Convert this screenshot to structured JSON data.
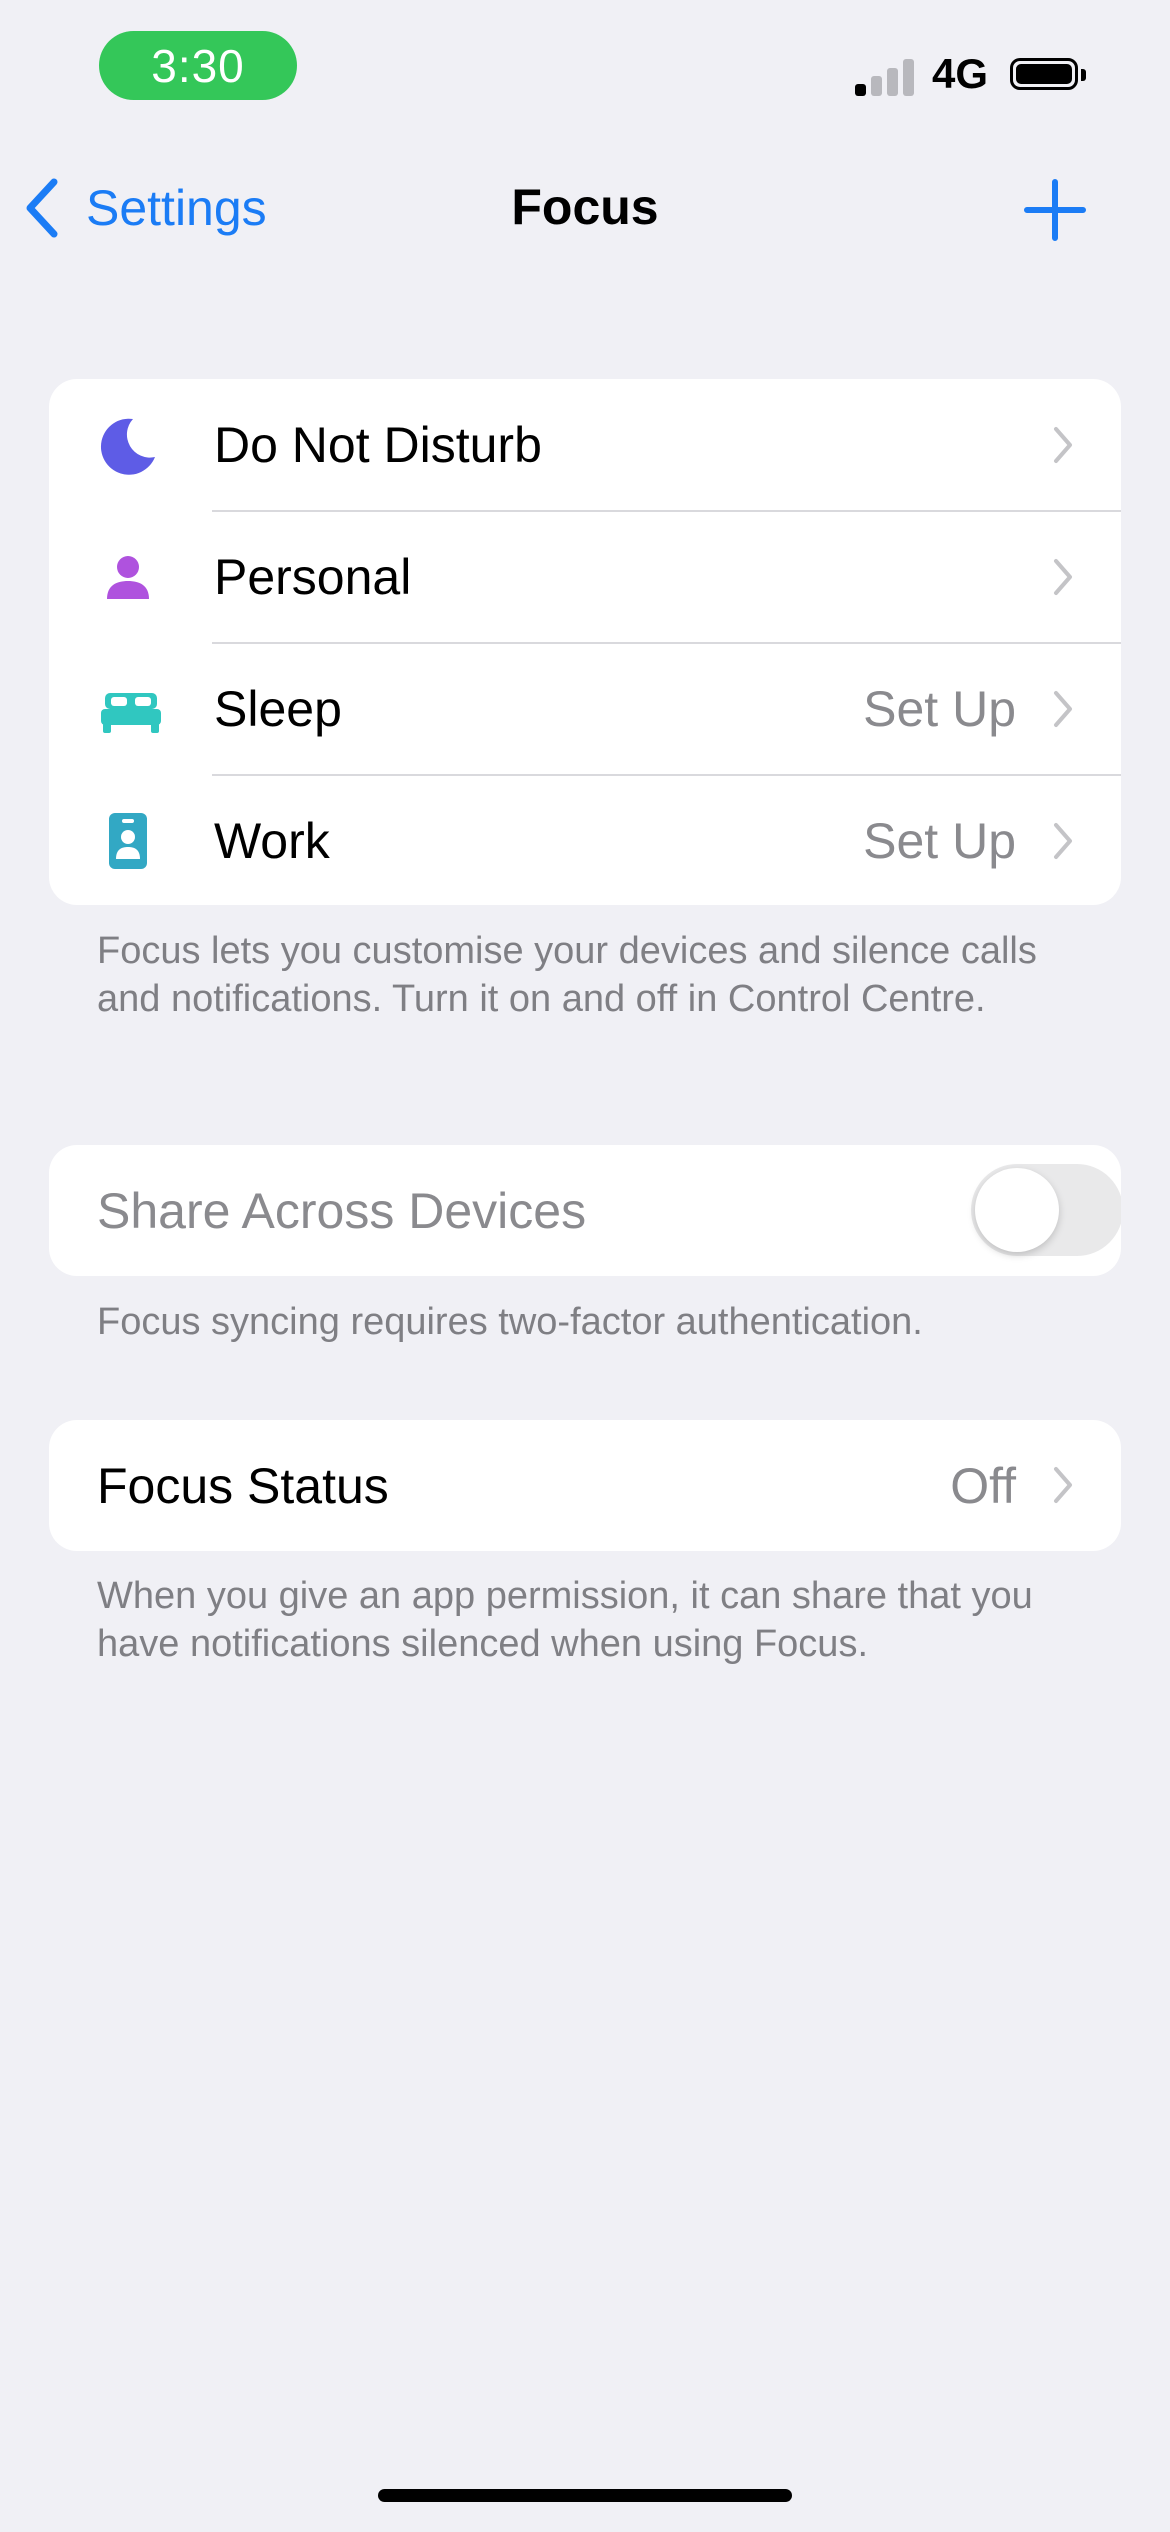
{
  "status_bar": {
    "time": "3:30",
    "network": "4G",
    "signal_bars_active": 1,
    "signal_bars_total": 4,
    "time_pill_color": "#34c759"
  },
  "nav": {
    "back_label": "Settings",
    "title": "Focus",
    "add_icon": "plus-icon",
    "accent_color": "#1b7cf5"
  },
  "focus_modes": [
    {
      "label": "Do Not Disturb",
      "value": "",
      "icon": "moon-icon",
      "icon_color": "#5e5ce6"
    },
    {
      "label": "Personal",
      "value": "",
      "icon": "person-icon",
      "icon_color": "#af52de"
    },
    {
      "label": "Sleep",
      "value": "Set Up",
      "icon": "bed-icon",
      "icon_color": "#30c7c0"
    },
    {
      "label": "Work",
      "value": "Set Up",
      "icon": "id-badge-icon",
      "icon_color": "#32a8c4"
    }
  ],
  "focus_modes_footer": "Focus lets you customise your devices and silence calls and notifications. Turn it on and off in Control Centre.",
  "share": {
    "label": "Share Across Devices",
    "enabled": false,
    "footer": "Focus syncing requires two-factor authentication."
  },
  "focus_status": {
    "label": "Focus Status",
    "value": "Off",
    "footer": "When you give an app permission, it can share that you have notifications silenced when using Focus."
  }
}
